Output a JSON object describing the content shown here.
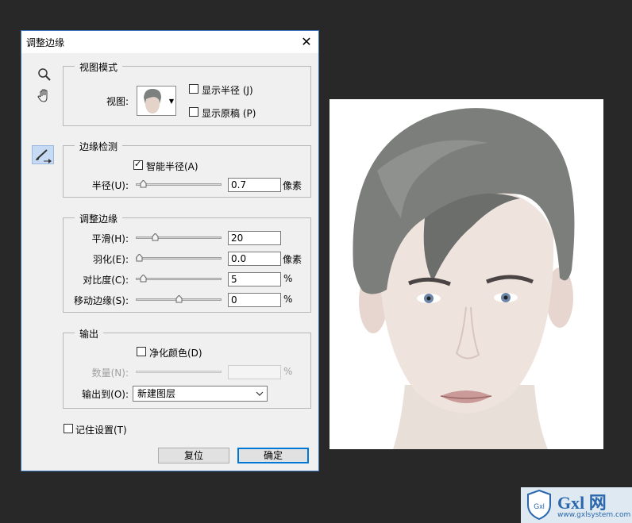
{
  "dialog": {
    "title": "调整边缘",
    "close_icon": "close-icon",
    "tools": [
      "zoom-icon",
      "hand-icon",
      "refine-radius-brush-icon"
    ]
  },
  "view_mode": {
    "title": "视图模式",
    "view_label": "视图:",
    "show_radius": {
      "label": "显示半径 (J)",
      "checked": false
    },
    "show_original": {
      "label": "显示原稿 (P)",
      "checked": false
    }
  },
  "edge_detection": {
    "title": "边缘检测",
    "smart_radius": {
      "label": "智能半径(A)",
      "checked": true
    },
    "radius": {
      "label": "半径(U):",
      "value": "0.7",
      "unit": "像素",
      "level": 0.05
    }
  },
  "adjust_edge": {
    "title": "调整边缘",
    "smooth": {
      "label": "平滑(H):",
      "value": "20",
      "unit": "",
      "level": 0.2
    },
    "feather": {
      "label": "羽化(E):",
      "value": "0.0",
      "unit": "像素",
      "level": 0.0
    },
    "contrast": {
      "label": "对比度(C):",
      "value": "5",
      "unit": "%",
      "level": 0.05
    },
    "shift_edge": {
      "label": "移动边缘(S):",
      "value": "0",
      "unit": "%",
      "level": 0.5
    }
  },
  "output": {
    "title": "输出",
    "decontaminate": {
      "label": "净化颜色(D)",
      "checked": false
    },
    "amount": {
      "label": "数量(N):",
      "value": "",
      "unit": "%"
    },
    "output_to": {
      "label": "输出到(O):",
      "selected": "新建图层"
    }
  },
  "remember": {
    "label": "记住设置(T)",
    "checked": false
  },
  "buttons": {
    "reset": "复位",
    "ok": "确定"
  },
  "watermark": {
    "text": "Gxl 网",
    "url": "www.gxlsystem.com"
  },
  "colors": {
    "accent": "#0078d7",
    "background": "#282828",
    "dialog": "#f0f0f0"
  }
}
